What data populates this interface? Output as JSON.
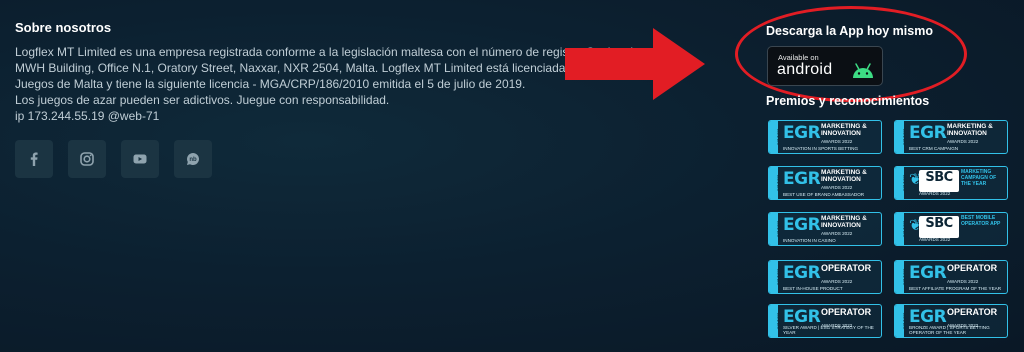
{
  "about": {
    "title": "Sobre nosotros",
    "lines": [
      "Logflex MT Limited es una empresa registrada conforme a la legislación maltesa con el número de registro C... legal:",
      "MWH Building, Office N.1, Oratory Street, Naxxar, NXR 2504, Malta. Logflex MT Limited está licenciada y regu... dad de",
      "Juegos de Malta y tiene la siguiente licencia - MGA/CRP/186/2010 emitida el 5 de julio de 2019.",
      "Los juegos de azar pueden ser adictivos. Juegue con responsabilidad.",
      "ip 173.244.55.19 @web-71"
    ]
  },
  "socials": [
    {
      "icon": "facebook-icon"
    },
    {
      "icon": "instagram-icon"
    },
    {
      "icon": "youtube-icon"
    },
    {
      "icon": "nb-icon"
    }
  ],
  "app": {
    "title": "Descarga la App hoy mismo",
    "available": "Available on",
    "platform": "android"
  },
  "awards": {
    "title": "Premios y reconocimientos",
    "items": [
      {
        "logo": "EGR",
        "head": "MARKETING & INNOVATION",
        "year": "AWARDS 2022",
        "sub": "INNOVATION IN SPORTS BETTING"
      },
      {
        "logo": "EGR",
        "head": "MARKETING & INNOVATION",
        "year": "AWARDS 2022",
        "sub": "BEST CRM CAMPAIGN"
      },
      {
        "logo": "EGR",
        "head": "MARKETING & INNOVATION",
        "year": "AWARDS 2022",
        "sub": "BEST USE OF BRAND AMBASSADOR"
      },
      {
        "logo": "SBC",
        "head": "MARKETING CAMPAIGN OF THE YEAR",
        "year": "AWARDS 2022",
        "sub": ""
      },
      {
        "logo": "EGR",
        "head": "MARKETING & INNOVATION",
        "year": "AWARDS 2022",
        "sub": "INNOVATION IN CASINO"
      },
      {
        "logo": "SBC",
        "head": "BEST MOBILE OPERATOR APP",
        "year": "AWARDS 2022",
        "sub": ""
      },
      {
        "logo": "EGR",
        "head": "OPERATOR",
        "year": "AWARDS 2022",
        "sub": "BEST IN-HOUSE PRODUCT"
      },
      {
        "logo": "EGR",
        "head": "OPERATOR",
        "year": "AWARDS 2022",
        "sub": "BEST AFFILIATE PROGRAM OF THE YEAR"
      },
      {
        "logo": "EGR",
        "head": "OPERATOR",
        "year": "AWARDS 2022",
        "sub": "SILVER AWARD | ESG STRATEGY OF THE YEAR"
      },
      {
        "logo": "EGR",
        "head": "OPERATOR",
        "year": "AWARDS 2022",
        "sub": "BRONZE AWARD | SPORTS BETTING OPERATOR OF THE YEAR"
      }
    ],
    "strip_label": "WINNER"
  },
  "colors": {
    "accent": "#32c1e8",
    "highlight": "#e21d24",
    "android_green": "#3ddc84"
  }
}
